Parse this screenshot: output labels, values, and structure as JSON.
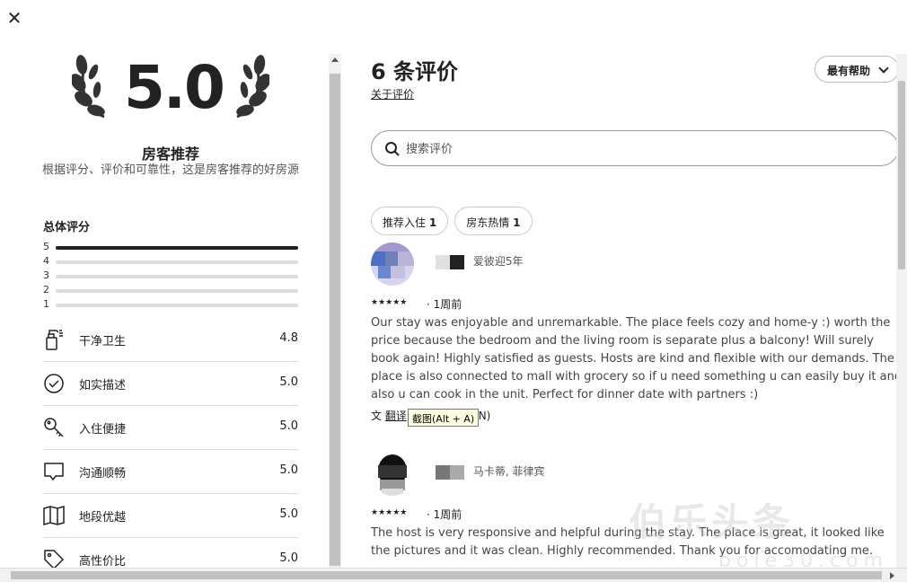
{
  "close_label": "✕",
  "summary": {
    "rating": "5.0",
    "title": "房客推荐",
    "description": "根据评分、评价和可靠性，这是房客推荐的好房源"
  },
  "overall": {
    "title": "总体评分",
    "bars": [
      {
        "label": "5",
        "fraction": 1.0
      },
      {
        "label": "4",
        "fraction": 0
      },
      {
        "label": "3",
        "fraction": 0
      },
      {
        "label": "2",
        "fraction": 0
      },
      {
        "label": "1",
        "fraction": 0
      }
    ]
  },
  "categories": [
    {
      "label": "干净卫生",
      "value": "4.8",
      "icon": "spray-bottle-icon"
    },
    {
      "label": "如实描述",
      "value": "5.0",
      "icon": "check-circle-icon"
    },
    {
      "label": "入住便捷",
      "value": "5.0",
      "icon": "key-icon"
    },
    {
      "label": "沟通顺畅",
      "value": "5.0",
      "icon": "chat-bubble-icon"
    },
    {
      "label": "地段优越",
      "value": "5.0",
      "icon": "map-icon"
    },
    {
      "label": "高性价比",
      "value": "5.0",
      "icon": "price-tag-icon"
    }
  ],
  "reviews_header": {
    "title": "6 条评价",
    "about_link": "关于评价",
    "sort_label": "最有帮助"
  },
  "search": {
    "placeholder": "搜索评价"
  },
  "chips": [
    {
      "label": "推荐入住",
      "count": "1"
    },
    {
      "label": "房东热情",
      "count": "1"
    }
  ],
  "reviews": [
    {
      "name": "爱彼迎5年",
      "stars": "★★★★★",
      "date": "· 1周前",
      "text": "Our stay was enjoyable and unremarkable. The place feels cozy and home-y :) worth the price because the bedroom and the living room is separate plus a balcony! Will surely book again! Highly satisfied as guests. Hosts are kind and flexible with our demands. The place is also connected to mall with grocery so if u need something u can easily buy it and also u can cook in the unit. Perfect for dinner date with partners :)",
      "translate_label": "翻译",
      "translate_suffix": "N)"
    },
    {
      "name": "马卡蒂, 菲律宾",
      "stars": "★★★★★",
      "date": "· 1周前",
      "text": "The host is very responsive and helpful during the stay. The place is great, it looked like the pictures and it was clean. Highly recommended. Thank you for accomodating me."
    }
  ],
  "tooltip": "截图(Alt + A)",
  "watermark": {
    "line1": "伯乐头条",
    "line2": "bole30.com"
  },
  "colors": {
    "text": "#222222",
    "muted": "#555555",
    "divider": "#dddddd"
  }
}
